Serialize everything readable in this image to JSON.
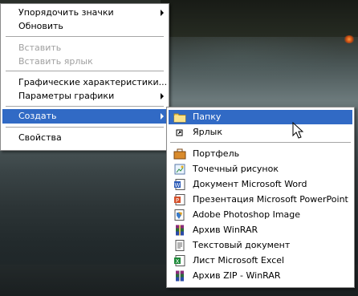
{
  "context_menu": {
    "items": [
      {
        "label": "Упорядочить значки",
        "enabled": true,
        "submenu": true
      },
      {
        "label": "Обновить",
        "enabled": true
      },
      {
        "label": "Вставить",
        "enabled": false
      },
      {
        "label": "Вставить ярлык",
        "enabled": false
      },
      {
        "label": "Графические характеристики...",
        "enabled": true
      },
      {
        "label": "Параметры графики",
        "enabled": true,
        "submenu": true
      },
      {
        "label": "Создать",
        "enabled": true,
        "submenu": true,
        "highlighted": true
      },
      {
        "label": "Свойства",
        "enabled": true
      }
    ]
  },
  "create_submenu": {
    "items": [
      {
        "label": "Папку",
        "icon": "folder-icon",
        "highlighted": true
      },
      {
        "label": "Ярлык",
        "icon": "shortcut-icon"
      },
      {
        "label": "Портфель",
        "icon": "briefcase-icon"
      },
      {
        "label": "Точечный рисунок",
        "icon": "bitmap-icon"
      },
      {
        "label": "Документ Microsoft Word",
        "icon": "word-document-icon"
      },
      {
        "label": "Презентация Microsoft PowerPoint",
        "icon": "powerpoint-icon"
      },
      {
        "label": "Adobe Photoshop Image",
        "icon": "photoshop-icon"
      },
      {
        "label": "Архив WinRAR",
        "icon": "winrar-icon"
      },
      {
        "label": "Текстовый документ",
        "icon": "text-document-icon"
      },
      {
        "label": "Лист Microsoft Excel",
        "icon": "excel-icon"
      },
      {
        "label": "Архив ZIP - WinRAR",
        "icon": "winrar-zip-icon"
      }
    ]
  },
  "colors": {
    "highlight": "#316ac5",
    "disabled_text": "#a0a0a0"
  }
}
